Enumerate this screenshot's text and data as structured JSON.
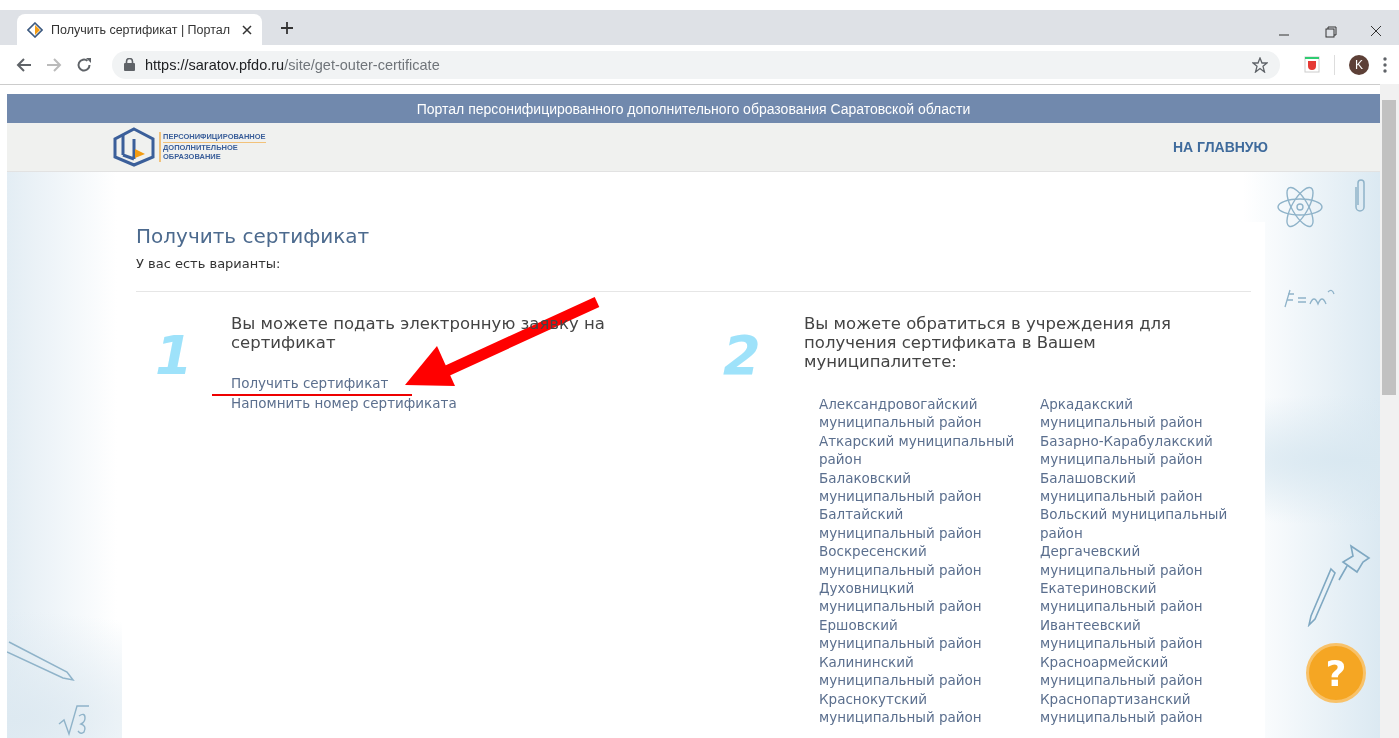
{
  "browser": {
    "tab": {
      "title": "Получить сертификат | Портал"
    },
    "address": {
      "host": "https://saratov.pfdo.ru",
      "path": "/site/get-outer-certificate"
    },
    "profile": {
      "initial": "K"
    }
  },
  "banner": {
    "text": "Портал персонифицированного дополнительного образования Саратовской области"
  },
  "header": {
    "logo_lines": [
      "ПЕРСОНИФИЦИРОВАННОЕ",
      "ДОПОЛНИТЕЛЬНОЕ",
      "ОБРАЗОВАНИЕ"
    ],
    "nav": [
      "НА ГЛАВНУЮ"
    ]
  },
  "page": {
    "title": "Получить сертификат",
    "subtitle": "У вас есть варианты:",
    "options": [
      {
        "kind": "links",
        "number": "1",
        "heading": "Вы можете подать электронную заявку на сертификат",
        "links": [
          "Получить сертификат",
          "Напомнить номер сертификата"
        ]
      },
      {
        "kind": "districts",
        "number": "2",
        "heading": "Вы можете обратиться в учреждения для получения сертификата в Вашем муниципалитете:",
        "districts": [
          [
            "Александровогайский муниципальный район",
            "Аткарский муниципальный район",
            "Балаковский муниципальный район",
            "Балтайский муниципальный район",
            "Воскресенский муниципальный район",
            "Духовницкий муниципальный район",
            "Ершовский муниципальный район",
            "Калининский муниципальный район",
            "Краснокутский муниципальный район"
          ],
          [
            "Аркадакский муниципальный район",
            "Базарно-Карабулакский муниципальный район",
            "Балашовский муниципальный район",
            "Вольский муниципальный район",
            "Дергачевский муниципальный район",
            "Екатериновский муниципальный район",
            "Ивантеевский муниципальный район",
            "Красноармейский муниципальный район",
            "Краснопартизанский муниципальный район"
          ]
        ]
      }
    ]
  },
  "help_button": {
    "label": "?"
  }
}
